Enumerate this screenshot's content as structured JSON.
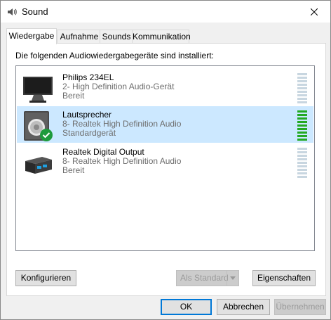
{
  "window": {
    "title": "Sound",
    "close_glyph": "✕"
  },
  "tabs": [
    {
      "label": "Wiedergabe",
      "active": true
    },
    {
      "label": "Aufnahme",
      "active": false
    },
    {
      "label": "Sounds",
      "active": false
    },
    {
      "label": "Kommunikation",
      "active": false
    }
  ],
  "playback": {
    "instruction": "Die folgenden Audiowiedergabegeräte sind installiert:",
    "devices": [
      {
        "name": "Philips 234EL",
        "description": "2- High Definition Audio-Gerät",
        "status": "Bereit",
        "icon": "monitor-icon",
        "selected": false,
        "default": false,
        "level": 0
      },
      {
        "name": "Lautsprecher",
        "description": "8- Realtek High Definition Audio",
        "status": "Standardgerät",
        "icon": "speaker-icon",
        "selected": true,
        "default": true,
        "level": 1.0
      },
      {
        "name": "Realtek Digital Output",
        "description": "8- Realtek High Definition Audio",
        "status": "Bereit",
        "icon": "digital-output-icon",
        "selected": false,
        "default": false,
        "level": 0
      }
    ]
  },
  "buttons": {
    "configure": "Konfigurieren",
    "set_default": "Als Standard",
    "properties": "Eigenschaften",
    "ok": "OK",
    "cancel": "Abbrechen",
    "apply": "Übernehmen"
  },
  "colors": {
    "selection": "#cce8ff",
    "meter_active": "#23a923",
    "meter_idle": "#c8d6e0",
    "default_badge": "#1e9a3c"
  }
}
